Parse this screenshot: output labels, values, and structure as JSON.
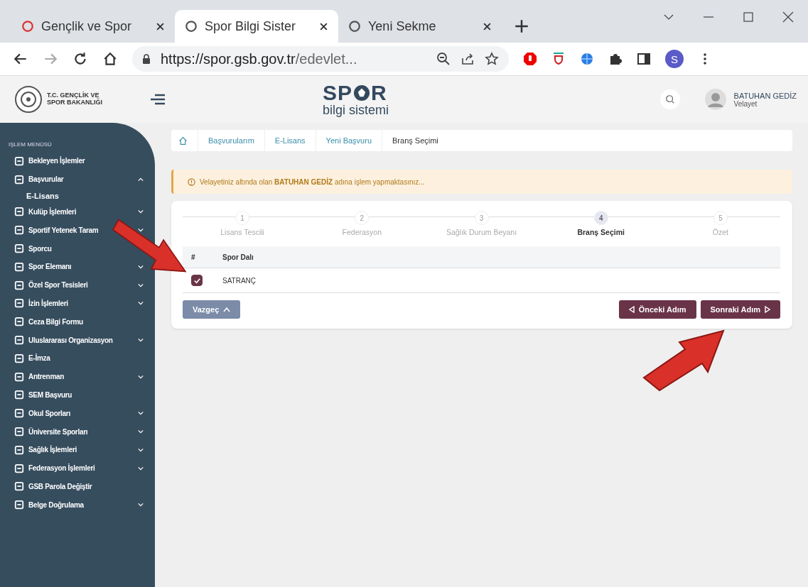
{
  "browser": {
    "tabs": [
      {
        "title": "Gençlik ve Spor",
        "selected": false
      },
      {
        "title": "Spor Bilgi Sister",
        "selected": true
      },
      {
        "title": "Yeni Sekme",
        "selected": false
      }
    ],
    "url_host": "https://spor.gsb.gov.tr",
    "url_path": "/edevlet...",
    "profile_initial": "S"
  },
  "header": {
    "ministry": "T.C. GENÇLİK VE SPOR BAKANLIĞI",
    "logo_top": "SP",
    "logo_top_end": "R",
    "logo_bottom": "bilgi sistemi",
    "user_name": "BATUHAN GEDİZ",
    "user_role": "Velayet"
  },
  "sidebar": {
    "title": "IŞLEM MENÜSÜ",
    "items": [
      {
        "label": "Bekleyen İşlemler",
        "kind": "link"
      },
      {
        "label": "Başvurular",
        "kind": "group",
        "expanded": true
      },
      {
        "label": "E-Lisans",
        "kind": "sub"
      },
      {
        "label": "Kulüp İşlemleri",
        "kind": "group",
        "expanded": false
      },
      {
        "label": "Sportif Yetenek Taram",
        "kind": "group",
        "expanded": false
      },
      {
        "label": "Sporcu",
        "kind": "link"
      },
      {
        "label": "Spor Elemanı",
        "kind": "group",
        "expanded": false
      },
      {
        "label": "Özel Spor Tesisleri",
        "kind": "group",
        "expanded": false
      },
      {
        "label": "İzin İşlemleri",
        "kind": "group",
        "expanded": false
      },
      {
        "label": "Ceza Bilgi Formu",
        "kind": "link"
      },
      {
        "label": "Uluslararası Organizasyon",
        "kind": "group",
        "expanded": false
      },
      {
        "label": "E-İmza",
        "kind": "link"
      },
      {
        "label": "Antrenman",
        "kind": "group",
        "expanded": false
      },
      {
        "label": "SEM Başvuru",
        "kind": "link"
      },
      {
        "label": "Okul Sporları",
        "kind": "group",
        "expanded": false
      },
      {
        "label": "Üniversite Sporları",
        "kind": "group",
        "expanded": false
      },
      {
        "label": "Sağlık İşlemleri",
        "kind": "group",
        "expanded": false
      },
      {
        "label": "Federasyon İşlemleri",
        "kind": "group",
        "expanded": false
      },
      {
        "label": "GSB Parola Değiştir",
        "kind": "link"
      },
      {
        "label": "Belge Doğrulama",
        "kind": "group",
        "expanded": false
      }
    ]
  },
  "breadcrumb": [
    {
      "label": "Başvurularım",
      "selected": false
    },
    {
      "label": "E-Lisans",
      "selected": false
    },
    {
      "label": "Yeni Başvuru",
      "selected": false
    },
    {
      "label": "Branş Seçimi",
      "selected": true
    }
  ],
  "notice": "Velayetiniz altında olan **BATUHAN GEDİZ** adına işlem yapmaktasınız...",
  "steps": [
    {
      "number": "1",
      "label": "Lisans Tescili",
      "selected": false
    },
    {
      "number": "2",
      "label": "Federasyon",
      "selected": false
    },
    {
      "number": "3",
      "label": "Sağlık Durum Beyanı",
      "selected": false
    },
    {
      "number": "4",
      "label": "Branş Seçimi",
      "selected": true
    },
    {
      "number": "5",
      "label": "Özet",
      "selected": false
    }
  ],
  "table": {
    "columns": [
      "#",
      "Spor Dalı"
    ],
    "rows": [
      {
        "checked": true,
        "branch": "SATRANÇ"
      }
    ]
  },
  "buttons": {
    "cancel": "Vazgeç",
    "previous": "Önceki Adım",
    "next": "Sonraki Adım"
  }
}
